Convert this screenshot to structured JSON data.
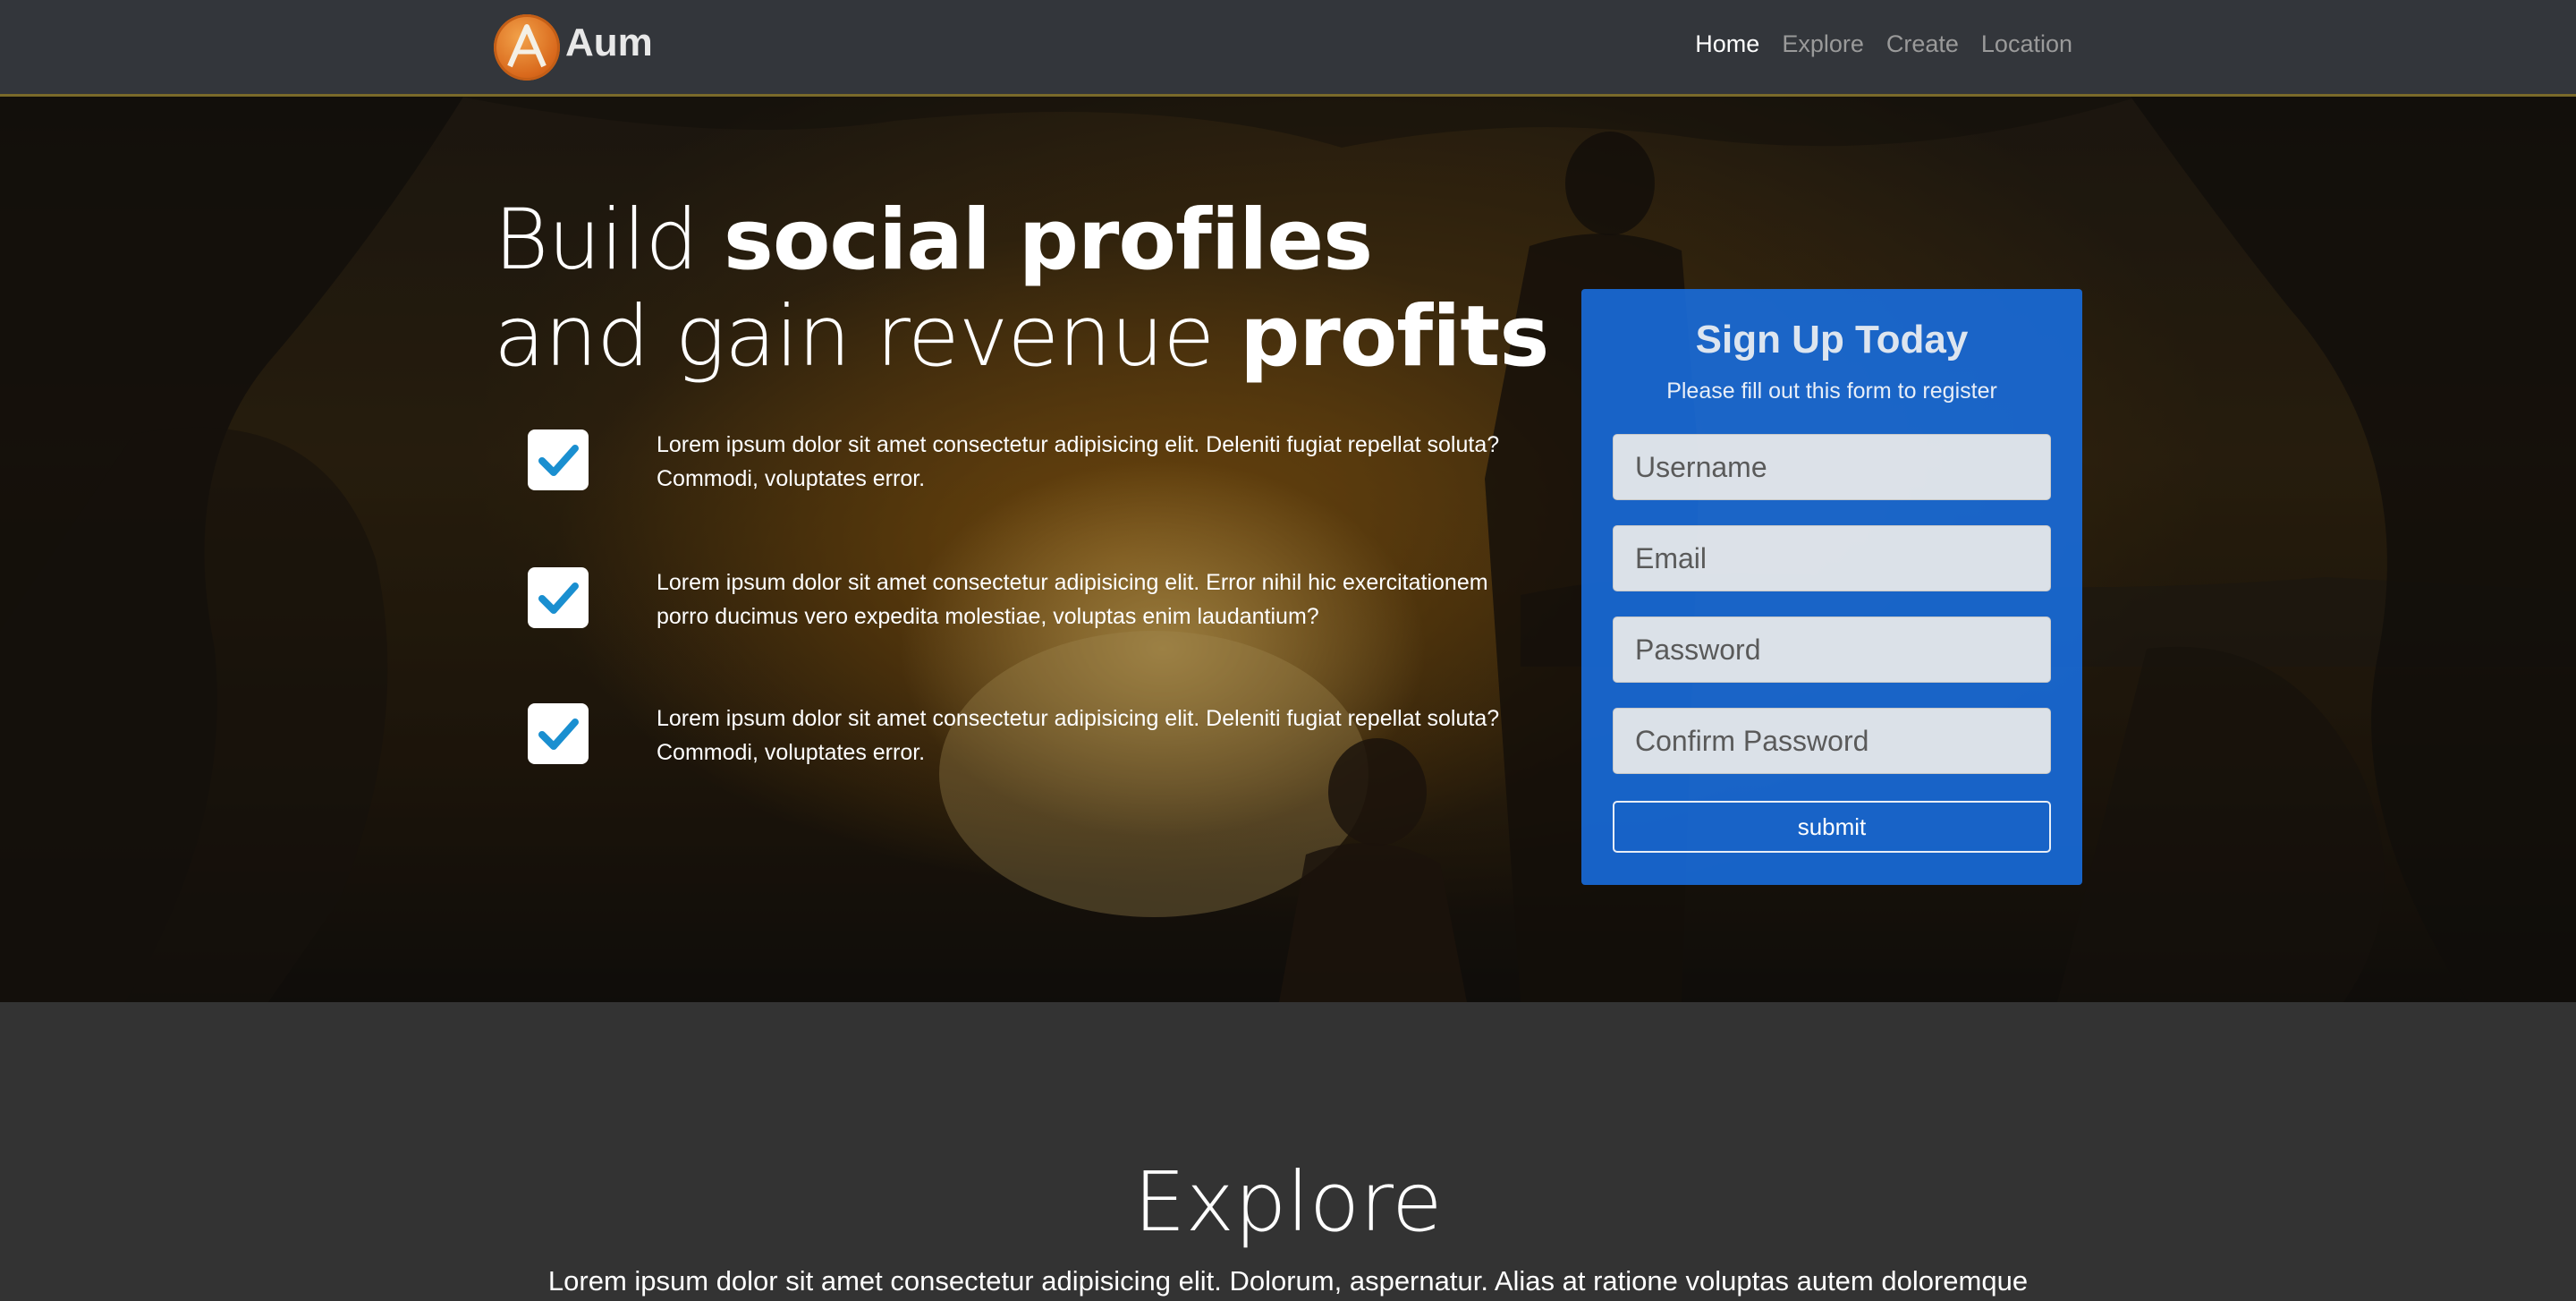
{
  "navbar": {
    "brand": "Aum",
    "links": [
      {
        "label": "Home",
        "active": true
      },
      {
        "label": "Explore",
        "active": false
      },
      {
        "label": "Create",
        "active": false
      },
      {
        "label": "Location",
        "active": false
      }
    ]
  },
  "hero": {
    "headline": {
      "part1": "Build ",
      "bold1": "social profiles",
      "part2": " and gain revenue ",
      "bold2": "profits"
    },
    "features": [
      "Lorem ipsum dolor sit amet consectetur adipisicing elit. Deleniti fugiat repellat soluta? Commodi, voluptates error.",
      "Lorem ipsum dolor sit amet consectetur adipisicing elit. Error nihil hic exercitationem porro ducimus vero expedita molestiae, voluptas enim laudantium?",
      "Lorem ipsum dolor sit amet consectetur adipisicing elit. Deleniti fugiat repellat soluta? Commodi, voluptates error."
    ]
  },
  "signup": {
    "title": "Sign Up Today",
    "subtitle": "Please fill out this form to register",
    "username_placeholder": "Username",
    "email_placeholder": "Email",
    "password_placeholder": "Password",
    "confirm_placeholder": "Confirm Password",
    "submit_label": "submit",
    "accent_color": "#1a6ee0"
  },
  "explore": {
    "title": "Explore",
    "text": "Lorem ipsum dolor sit amet consectetur adipisicing elit. Dolorum, aspernatur. Alias at ratione voluptas autem doloremque"
  },
  "icons": {
    "logo": "a-logo-icon",
    "check": "check-icon"
  }
}
